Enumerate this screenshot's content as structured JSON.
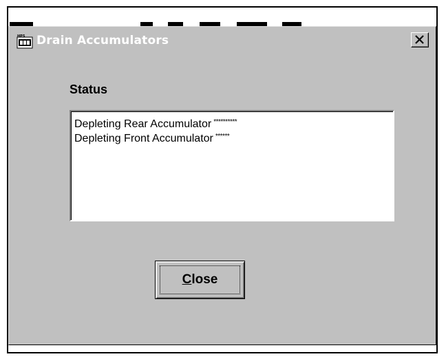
{
  "dialog": {
    "title": "Drain Accumulators",
    "status_label": "Status",
    "status_lines": [
      {
        "text": "Depleting Rear Accumulator",
        "progress_marks": "**********"
      },
      {
        "text": "Depleting Front Accumulator",
        "progress_marks": "******"
      }
    ],
    "close_button": {
      "mnemonic": "C",
      "rest": "lose"
    }
  },
  "colors": {
    "dialog_face": "#c0c0c0",
    "title_text": "#ffffff",
    "list_background": "#ffffff"
  },
  "icons": {
    "title": "hps-app-icon",
    "close": "close-x-icon"
  }
}
